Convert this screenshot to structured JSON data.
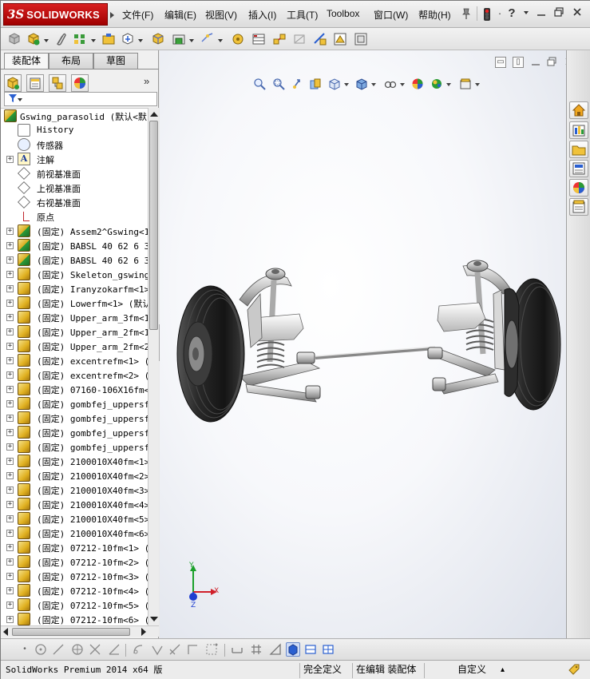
{
  "app": {
    "logo_ds": "3S",
    "logo_text": "SOLIDWORKS"
  },
  "menu": {
    "items": [
      "文件(F)",
      "编辑(E)",
      "视图(V)",
      "插入(I)",
      "工具(T)",
      "Toolbox",
      "窗口(W)",
      "帮助(H)"
    ]
  },
  "panel": {
    "tabs": [
      "装配体",
      "布局",
      "草图"
    ],
    "active_tab": "装配体",
    "expand_chevron": "»"
  },
  "tree": {
    "root": "Gswing_parasolid  (默认<默",
    "items": [
      {
        "label": "History",
        "icon": "history-icon",
        "expandable": false
      },
      {
        "label": "传感器",
        "icon": "sensor-icon",
        "expandable": false
      },
      {
        "label": "注解",
        "icon": "annotation-icon",
        "expandable": true
      },
      {
        "label": "前视基准面",
        "icon": "plane-icon",
        "expandable": false
      },
      {
        "label": "上视基准面",
        "icon": "plane-icon",
        "expandable": false
      },
      {
        "label": "右视基准面",
        "icon": "plane-icon",
        "expandable": false
      },
      {
        "label": "原点",
        "icon": "origin-icon",
        "expandable": false
      },
      {
        "label": "(固定) Assem2^Gswing<1>",
        "icon": "assembly-icon",
        "expandable": true
      },
      {
        "label": "(固定) BABSL 40 62 6 30",
        "icon": "assembly-icon",
        "expandable": true
      },
      {
        "label": "(固定) BABSL 40 62 6 30",
        "icon": "assembly-icon",
        "expandable": true
      },
      {
        "label": "(固定) Skeleton_gswingf",
        "icon": "part-icon",
        "expandable": true
      },
      {
        "label": "(固定) Iranyzokarfm<1>",
        "icon": "part-icon",
        "expandable": true
      },
      {
        "label": "(固定) Lowerfm<1> (默认",
        "icon": "part-icon",
        "expandable": true
      },
      {
        "label": "(固定) Upper_arm_3fm<1>",
        "icon": "part-icon",
        "expandable": true
      },
      {
        "label": "(固定) Upper_arm_2fm<1>",
        "icon": "part-icon",
        "expandable": true
      },
      {
        "label": "(固定) Upper_arm_2fm<2>",
        "icon": "part-icon",
        "expandable": true
      },
      {
        "label": "(固定) excentrefm<1> (默",
        "icon": "part-icon",
        "expandable": true
      },
      {
        "label": "(固定) excentrefm<2> (默",
        "icon": "part-icon",
        "expandable": true
      },
      {
        "label": "(固定) 07160-106X16fm<1",
        "icon": "part-icon",
        "expandable": true
      },
      {
        "label": "(固定) gombfej_uppersfm",
        "icon": "part-icon",
        "expandable": true
      },
      {
        "label": "(固定) gombfej_uppersfm",
        "icon": "part-icon",
        "expandable": true
      },
      {
        "label": "(固定) gombfej_uppersfm",
        "icon": "part-icon",
        "expandable": true
      },
      {
        "label": "(固定) gombfej_uppersfm",
        "icon": "part-icon",
        "expandable": true
      },
      {
        "label": "(固定) 2100010X40fm<1>",
        "icon": "part-icon",
        "expandable": true
      },
      {
        "label": "(固定) 2100010X40fm<2>",
        "icon": "part-icon",
        "expandable": true
      },
      {
        "label": "(固定) 2100010X40fm<3>",
        "icon": "part-icon",
        "expandable": true
      },
      {
        "label": "(固定) 2100010X40fm<4>",
        "icon": "part-icon",
        "expandable": true
      },
      {
        "label": "(固定) 2100010X40fm<5>",
        "icon": "part-icon",
        "expandable": true
      },
      {
        "label": "(固定) 2100010X40fm<6>",
        "icon": "part-icon",
        "expandable": true
      },
      {
        "label": "(固定) 07212-10fm<1> (默",
        "icon": "part-icon",
        "expandable": true
      },
      {
        "label": "(固定) 07212-10fm<2> (默",
        "icon": "part-icon",
        "expandable": true
      },
      {
        "label": "(固定) 07212-10fm<3> (默",
        "icon": "part-icon",
        "expandable": true
      },
      {
        "label": "(固定) 07212-10fm<4> (默",
        "icon": "part-icon",
        "expandable": true
      },
      {
        "label": "(固定) 07212-10fm<5> (默",
        "icon": "part-icon",
        "expandable": true
      },
      {
        "label": "(固定) 07212-10fm<6> (默",
        "icon": "part-icon",
        "expandable": true
      }
    ]
  },
  "triad": {
    "x": "X",
    "y": "Y",
    "z": "Z"
  },
  "status": {
    "app_version": "SolidWorks Premium 2014 x64 版",
    "definition": "完全定义",
    "editing": "在编辑 装配体",
    "custom": "自定义",
    "custom_caret": "▴"
  },
  "colors": {
    "logo_red": "#b01010",
    "graphics_bg": "#f7f8fb",
    "triad_x": "#d0202a",
    "triad_y": "#1aa02a",
    "triad_z": "#1f3fd0"
  }
}
